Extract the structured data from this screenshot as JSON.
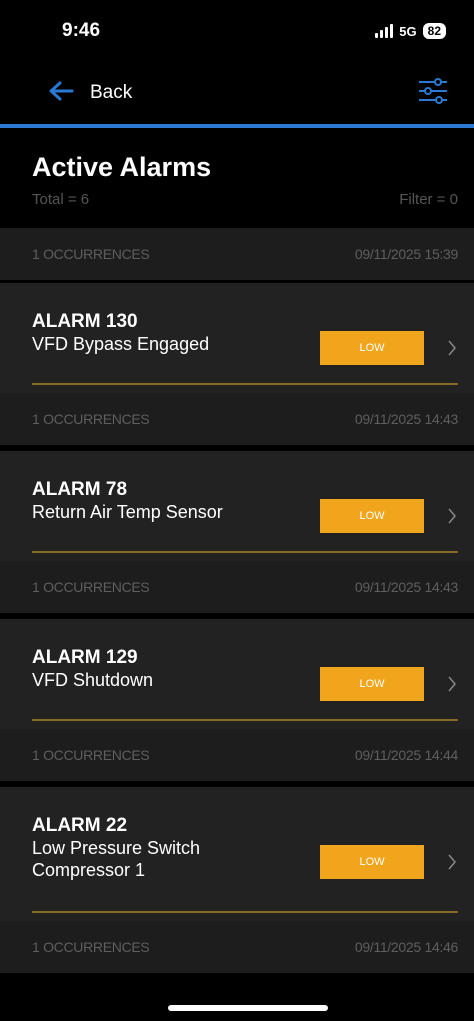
{
  "status": {
    "time": "9:46",
    "network": "5G",
    "battery": "82"
  },
  "nav": {
    "back_label": "Back",
    "back_icon": "arrow-left-icon",
    "filter_icon": "sliders-icon",
    "accent_color": "#2a79d3"
  },
  "header": {
    "title": "Active Alarms",
    "total": "Total = 6",
    "filter": "Filter = 0"
  },
  "first_occurrence": {
    "count": "1 OCCURRENCES",
    "timestamp": "09/11/2025 15:39"
  },
  "alarms": [
    {
      "name": "ALARM 130",
      "description": "VFD Bypass Engaged",
      "severity": "LOW",
      "occurrences": "1 OCCURRENCES",
      "timestamp": "09/11/2025 14:43"
    },
    {
      "name": "ALARM 78",
      "description": "Return Air Temp Sensor",
      "severity": "LOW",
      "occurrences": "1 OCCURRENCES",
      "timestamp": "09/11/2025 14:43"
    },
    {
      "name": "ALARM 129",
      "description": "VFD Shutdown",
      "severity": "LOW",
      "occurrences": "1 OCCURRENCES",
      "timestamp": "09/11/2025 14:44"
    },
    {
      "name": "ALARM 22",
      "description": "Low Pressure Switch Compressor 1",
      "severity": "LOW",
      "occurrences": "1 OCCURRENCES",
      "timestamp": "09/11/2025 14:46"
    }
  ],
  "colors": {
    "severity_low": "#f0a51d",
    "divider": "#8a6a22",
    "card_bg": "#222222"
  }
}
